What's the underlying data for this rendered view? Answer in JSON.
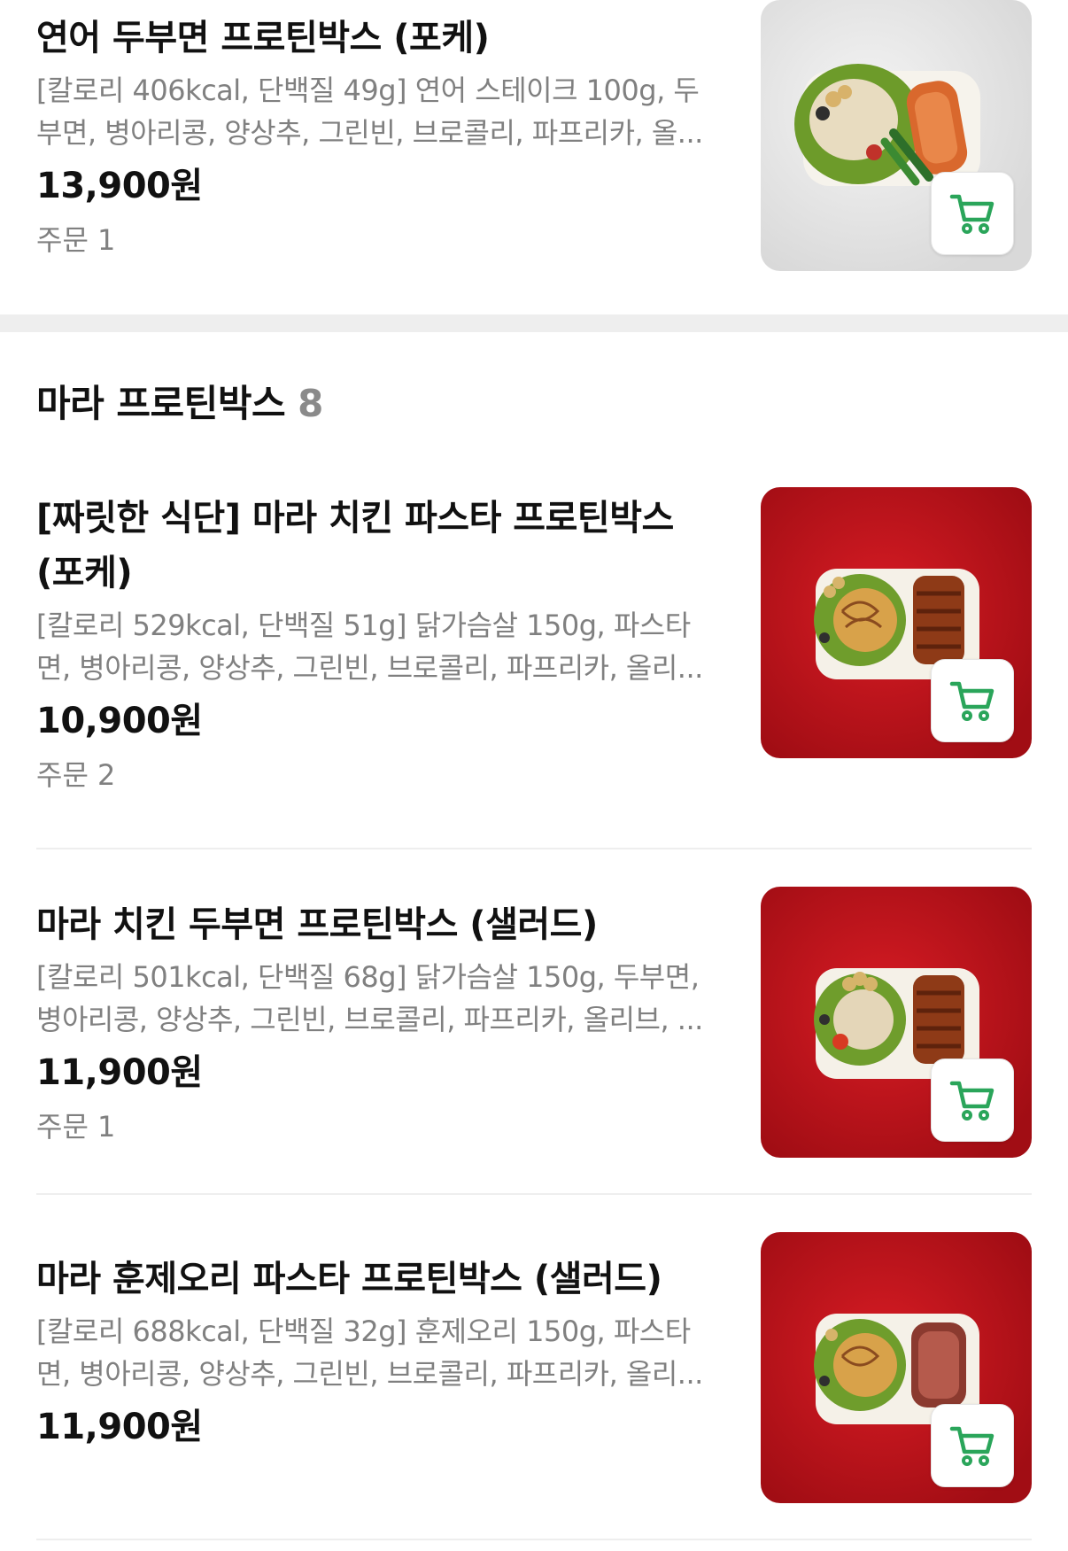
{
  "colors": {
    "accent_green": "#2aa55a",
    "divider": "#eeeeee",
    "muted_text": "#808080"
  },
  "items": [
    {
      "title": "연어 두부면 프로틴박스 (포케)",
      "description": "[칼로리 406kcal, 단백질 49g] 연어 스테이크 100g, 두부면, 병아리콩, 양상추, 그린빈, 브로콜리, 파프리카, 올...",
      "price": "13,900원",
      "orders": "주문 1",
      "image_icon": "salmon-bowl-photo",
      "cart_icon": "cart-icon"
    }
  ],
  "section": {
    "title": "마라 프로틴박스",
    "count": "8"
  },
  "section_items": [
    {
      "title": "[짜릿한 식단] 마라 치킨 파스타 프로틴박스 (포케)",
      "description": "[칼로리 529kcal, 단백질 51g] 닭가슴살 150g, 파스타면, 병아리콩, 양상추, 그린빈, 브로콜리, 파프리카, 올리...",
      "price": "10,900원",
      "orders": "주문 2",
      "image_icon": "mala-chicken-pasta-photo",
      "cart_icon": "cart-icon"
    },
    {
      "title": "마라 치킨 두부면 프로틴박스 (샐러드)",
      "description": "[칼로리 501kcal, 단백질 68g] 닭가슴살 150g, 두부면, 병아리콩, 양상추, 그린빈, 브로콜리, 파프리카, 올리브, ...",
      "price": "11,900원",
      "orders": "주문 1",
      "image_icon": "mala-chicken-tofu-photo",
      "cart_icon": "cart-icon"
    },
    {
      "title": "마라 훈제오리 파스타 프로틴박스 (샐러드)",
      "description": "[칼로리 688kcal, 단백질 32g] 훈제오리 150g, 파스타면, 병아리콩, 양상추, 그린빈, 브로콜리, 파프리카, 올리...",
      "price": "11,900원",
      "image_icon": "mala-duck-pasta-photo",
      "cart_icon": "cart-icon"
    }
  ]
}
